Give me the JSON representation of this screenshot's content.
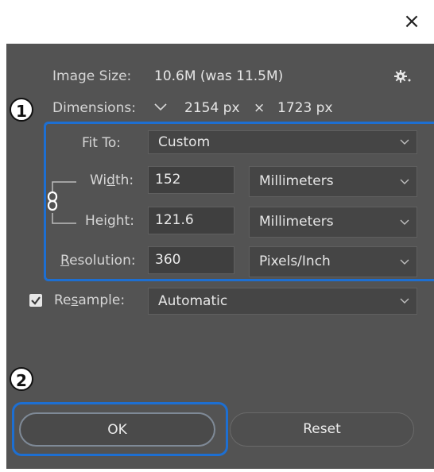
{
  "window": {
    "close_symbol": "×"
  },
  "image_size": {
    "label": "Image Size:",
    "value": "10.6M (was 11.5M)",
    "settings_icon": "gear-icon"
  },
  "dimensions": {
    "label": "Dimensions:",
    "width_value": "2154 px",
    "times": "×",
    "height_value": "1723 px"
  },
  "fit_to": {
    "label": "Fit To:",
    "value": "Custom"
  },
  "width": {
    "label_pre": "Wi",
    "label_mnemonic": "d",
    "label_post": "th:",
    "value": "152",
    "unit": "Millimeters"
  },
  "height": {
    "label_pre": "Hei",
    "label_mnemonic": "g",
    "label_post": "ht:",
    "value": "121.6",
    "unit": "Millimeters"
  },
  "resolution": {
    "label_mnemonic": "R",
    "label_post": "esolution:",
    "value": "360",
    "unit": "Pixels/Inch"
  },
  "resample": {
    "label_pre": "Re",
    "label_mnemonic": "s",
    "label_post": "ample:",
    "checked": true,
    "value": "Automatic"
  },
  "callouts": {
    "first": "1",
    "second": "2"
  },
  "buttons": {
    "ok": "OK",
    "reset": "Reset"
  },
  "colors": {
    "dialog_bg": "#535353",
    "highlight": "#1d6fd2",
    "field_bg": "#454545"
  }
}
